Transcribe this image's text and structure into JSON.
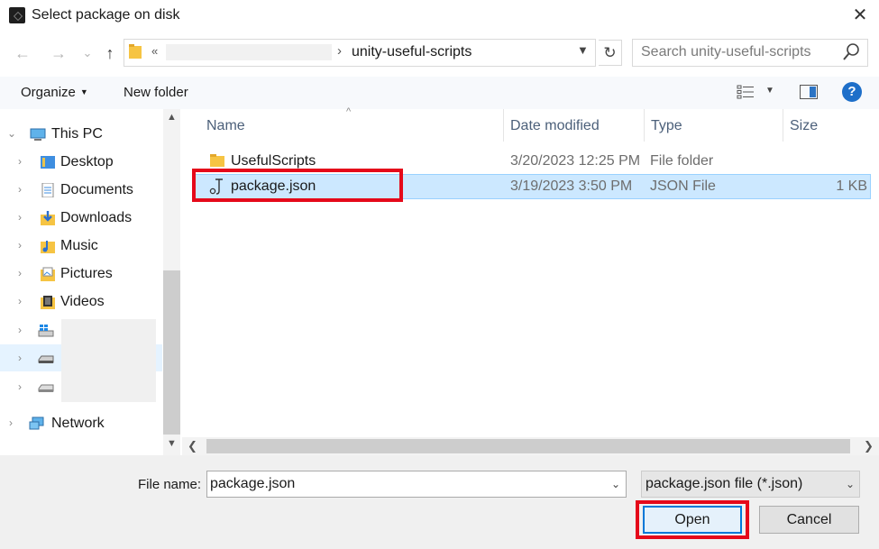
{
  "window": {
    "title": "Select package on disk",
    "close_label": "✕"
  },
  "address": {
    "nav_back": "←",
    "nav_forward": "→",
    "nav_recent": "⌄",
    "nav_up": "↑",
    "overflow": "«",
    "separator": "›",
    "current": "unity-useful-scripts",
    "refresh": "↻",
    "search_placeholder": "Search unity-useful-scripts"
  },
  "toolbar": {
    "organize": "Organize",
    "new_folder": "New folder",
    "help": "?"
  },
  "nav": {
    "items": [
      {
        "label": "This PC",
        "icon": "pc-icon"
      },
      {
        "label": "Desktop",
        "icon": "desktop-icon"
      },
      {
        "label": "Documents",
        "icon": "documents-icon"
      },
      {
        "label": "Downloads",
        "icon": "downloads-icon"
      },
      {
        "label": "Music",
        "icon": "music-icon"
      },
      {
        "label": "Pictures",
        "icon": "pictures-icon"
      },
      {
        "label": "Videos",
        "icon": "videos-icon"
      },
      {
        "label": "",
        "icon": "os-drive-icon"
      },
      {
        "label": "",
        "icon": "drive-icon"
      },
      {
        "label": "",
        "icon": "drive-icon"
      },
      {
        "label": "Network",
        "icon": "network-icon"
      }
    ]
  },
  "columns": {
    "name": "Name",
    "date": "Date modified",
    "type": "Type",
    "size": "Size"
  },
  "files": [
    {
      "name": "UsefulScripts",
      "date": "3/20/2023 12:25 PM",
      "type": "File folder",
      "size": "",
      "icon": "folder-icon"
    },
    {
      "name": "package.json",
      "date": "3/19/2023 3:50 PM",
      "type": "JSON File",
      "size": "1 KB",
      "icon": "json-file-icon"
    }
  ],
  "footer": {
    "filename_label": "File name:",
    "filename_value": "package.json",
    "filetype_value": "package.json file (*.json)",
    "open_label": "Open",
    "cancel_label": "Cancel"
  },
  "colors": {
    "highlight": "#e5091a",
    "selection": "#cce8ff",
    "accent": "#0078d7"
  }
}
